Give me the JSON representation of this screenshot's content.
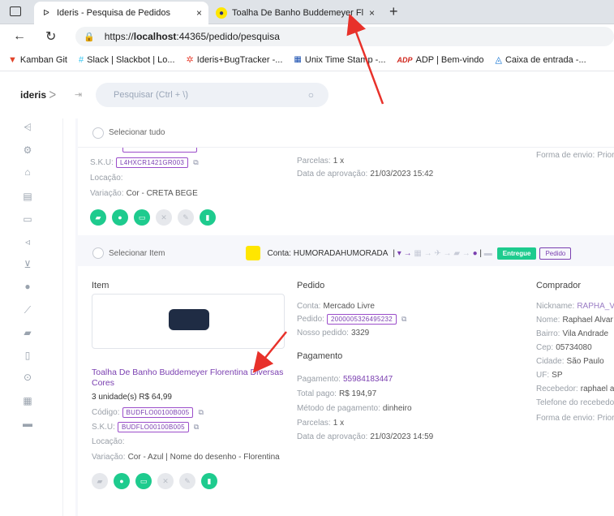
{
  "browser": {
    "tabs": [
      {
        "title": "Ideris - Pesquisa de Pedidos",
        "close": "×"
      },
      {
        "title": "Toalha De Banho Buddemeyer Fl",
        "close": "×"
      }
    ],
    "new_tab": "+",
    "url_prefix": "https://",
    "url_host": "localhost",
    "url_path": ":44365/pedido/pesquisa",
    "bookmarks": [
      {
        "label": "Kamban Git",
        "icon": "gitlab-icon"
      },
      {
        "label": "Slack | Slackbot | Lo...",
        "icon": "slack-icon"
      },
      {
        "label": "Ideris+BugTracker -...",
        "icon": "bug-icon"
      },
      {
        "label": "Unix Time Stamp -...",
        "icon": "calendar-icon"
      },
      {
        "label": "ADP | Bem-vindo",
        "icon": "adp-icon"
      },
      {
        "label": "Caixa de entrada -...",
        "icon": "mail-icon"
      }
    ]
  },
  "app": {
    "logo": "ideris",
    "search_placeholder": "Pesquisar (Ctrl + \\)"
  },
  "order1": {
    "select_all": "Selecionar tudo",
    "sku_label": "S.K.U:",
    "sku": "L4HXCR1421GR003",
    "location_label": "Locação:",
    "variation_label": "Variação:",
    "variation": "Cor - CRETA BEGE",
    "installments_label": "Parcelas:",
    "installments": "1 x",
    "approval_label": "Data de aprovação:",
    "approval": "21/03/2023 15:42",
    "shipping_label": "Forma de envio:",
    "shipping": "Priori"
  },
  "order2": {
    "select_item": "Selecionar Item",
    "account": "Conta: HUMORADAHUMORADA",
    "status": "Entregue",
    "status2": "Pedido",
    "item_title": "Item",
    "order_title": "Pedido",
    "buyer_title": "Comprador",
    "payment_title": "Pagamento",
    "product_name": "Toalha De Banho Buddemeyer Florentina Diversas Cores",
    "qty_price": "3 unidade(s) R$ 64,99",
    "code_label": "Código:",
    "code": "BUDFLO00100B005",
    "sku_label": "S.K.U:",
    "sku": "BUDFLO00100B005",
    "location_label": "Locação:",
    "variation_label": "Variação:",
    "variation": "Cor - Azul | Nome do desenho - Florentina",
    "account_label": "Conta:",
    "account_value": "Mercado Livre",
    "order_label": "Pedido:",
    "order_value": "2000005326495232",
    "our_order_label": "Nosso pedido:",
    "our_order_value": "3329",
    "payment_label": "Pagamento:",
    "payment_value": "55984183447",
    "total_label": "Total pago:",
    "total_value": "R$ 194,97",
    "method_label": "Método de pagamento:",
    "method_value": "dinheiro",
    "installments_label": "Parcelas:",
    "installments": "1 x",
    "approval_label": "Data de aprovação:",
    "approval": "21/03/2023 14:59",
    "nick_label": "Nickname:",
    "nick": "RAPHA_V",
    "name_label": "Nome:",
    "name": "Raphael Alvar",
    "district_label": "Bairro:",
    "district": "Vila Andrade",
    "cep_label": "Cep:",
    "cep": "05734080",
    "city_label": "Cidade:",
    "city": "São Paulo",
    "uf_label": "UF:",
    "uf": "SP",
    "receiver_label": "Recebedor:",
    "receiver": "raphael a",
    "phone_label": "Telefone do recebedor",
    "shipping_label": "Forma de envio:",
    "shipping": "Priori"
  },
  "colors": {
    "accent": "#7a3fb0",
    "green": "#1ecb8e",
    "annotation": "#e8312a"
  }
}
